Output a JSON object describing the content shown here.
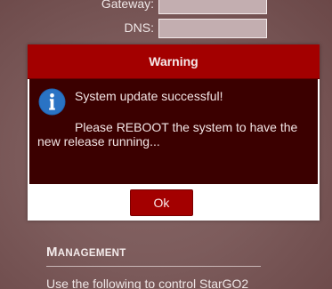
{
  "network_form": {
    "gateway": {
      "label": "Gateway:",
      "value": ""
    },
    "dns": {
      "label": "DNS:",
      "value": ""
    }
  },
  "dialog": {
    "title": "Warning",
    "icon": "info-icon",
    "message_line1": "System update successful!",
    "message_line2": "Please REBOOT the system to have the new release running...",
    "ok_label": "Ok"
  },
  "management": {
    "title_first": "M",
    "title_rest": "ANAGEMENT",
    "description": "Use the following to control StarGO2"
  },
  "colors": {
    "accent": "#a30000",
    "dialog_body": "#3b0000",
    "background": "#7d5c5c",
    "icon_blue": "#1f64b3"
  }
}
